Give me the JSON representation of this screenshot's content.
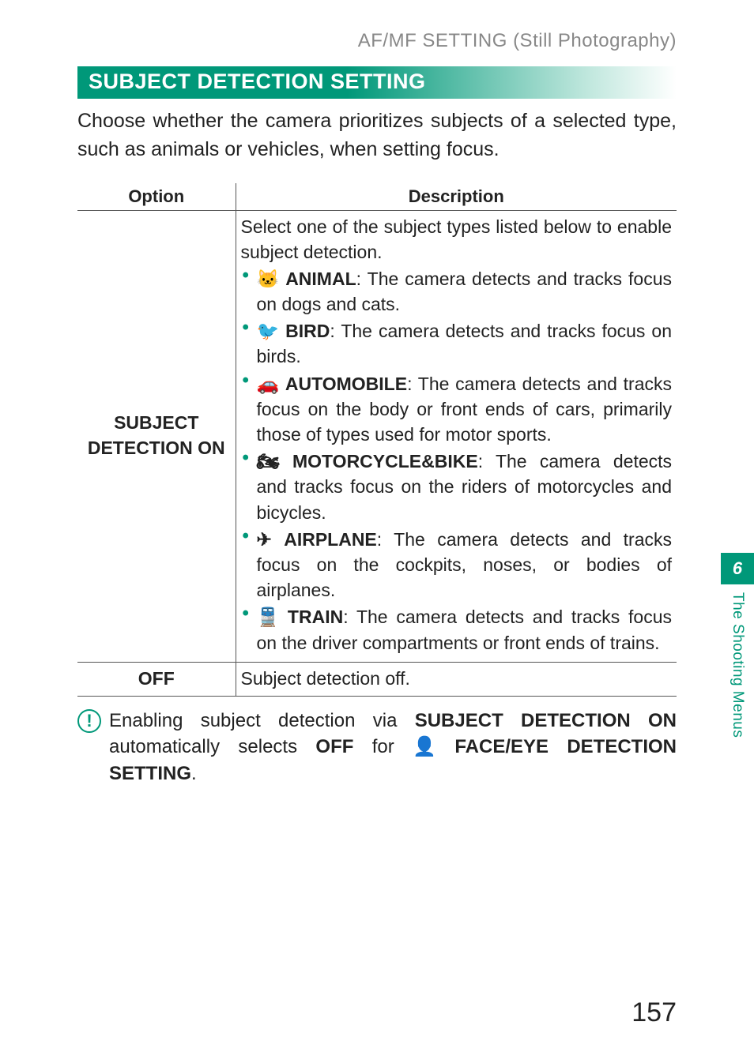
{
  "breadcrumb": "AF/MF SETTING (Still Photography)",
  "section_heading": "SUBJECT DETECTION SETTING",
  "intro": "Choose whether the camera prioritizes subjects of a selected type, such as animals or vehicles, when setting focus.",
  "table": {
    "headers": {
      "option": "Option",
      "description": "Description"
    },
    "rows": [
      {
        "option": "SUBJECT DETECTION ON",
        "lead": "Select one of the subject types listed below to enable subject detection.",
        "items": [
          {
            "icon": "animal-icon",
            "glyph": "🐱",
            "label": "ANIMAL",
            "text": ": The camera detects and tracks focus on dogs and cats."
          },
          {
            "icon": "bird-icon",
            "glyph": "🐦",
            "label": "BIRD",
            "text": ": The camera detects and tracks focus on birds."
          },
          {
            "icon": "automobile-icon",
            "glyph": "🚗",
            "label": "AUTOMOBILE",
            "text": ": The camera detects and tracks focus on the body or front ends of cars, primarily those of types used for motor sports."
          },
          {
            "icon": "motorcycle-icon",
            "glyph": "🏍",
            "label": "MOTORCYCLE&BIKE",
            "text": ": The camera detects and tracks focus on the riders of motorcycles and bicycles."
          },
          {
            "icon": "airplane-icon",
            "glyph": "✈",
            "label": "AIRPLANE",
            "text": ": The camera detects and tracks focus on the cockpits, noses, or bodies of airplanes."
          },
          {
            "icon": "train-icon",
            "glyph": "🚆",
            "label": "TRAIN",
            "text": ": The camera detects and tracks focus on the driver compartments or front ends of trains."
          }
        ]
      },
      {
        "option": "OFF",
        "description": "Subject detection off."
      }
    ]
  },
  "note": {
    "pre": "Enabling subject detection via ",
    "b1": "SUBJECT DETECTION ON",
    "mid": " automatically selects ",
    "b2": "OFF",
    "mid2": " for ",
    "face_icon_name": "face-detection-icon",
    "face_glyph": "👤",
    "b3": "FACE/EYE DETECTION SETTING",
    "post": "."
  },
  "side": {
    "chapter_number": "6",
    "chapter_name": "The Shooting Menus"
  },
  "page_number": "157"
}
